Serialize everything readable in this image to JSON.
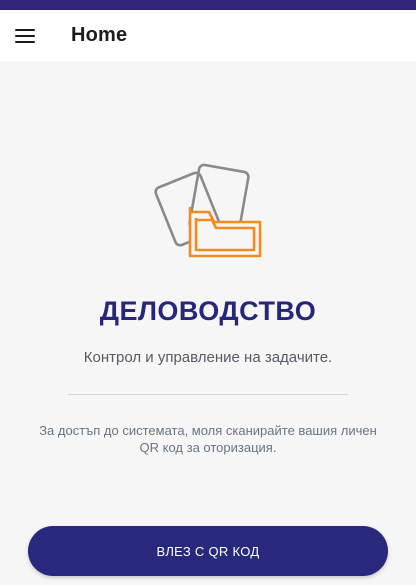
{
  "app_bar": {
    "title": "Home",
    "menu_icon": "hamburger-menu-icon"
  },
  "hero": {
    "icon": "documents-folder-icon",
    "app_name": "ДЕЛОВОДСТВО",
    "tagline": "Контрол и управление на задачите."
  },
  "instruction": "За достъп до системата, моля сканирайте вашия личен QR код за оторизация.",
  "login_button": {
    "label": "ВЛЕЗ С QR КОД"
  },
  "colors": {
    "status_bar": "#2f2478",
    "primary": "#28287c",
    "accent_orange": "#f28c1e",
    "icon_gray": "#8a8a8a",
    "background": "#f6f6f6"
  }
}
